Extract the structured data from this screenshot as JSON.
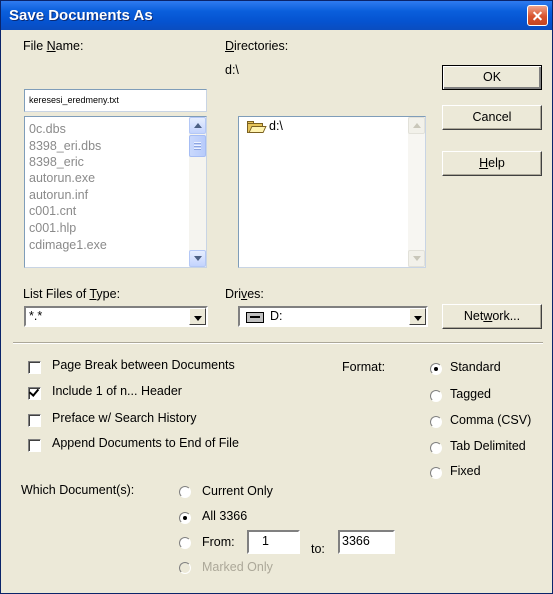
{
  "dialog": {
    "title": "Save Documents As"
  },
  "file_name": {
    "label_pre": "File ",
    "label_key": "N",
    "label_post": "ame:",
    "value": "keresesi_eredmeny.txt",
    "files": [
      "0c.dbs",
      "8398_eri.dbs",
      "8398_eric",
      "autorun.exe",
      "autorun.inf",
      "c001.cnt",
      "c001.hlp",
      "cdimage1.exe"
    ]
  },
  "directories": {
    "label_key": "D",
    "label_post": "irectories:",
    "path": "d:\\",
    "items": [
      "d:\\"
    ]
  },
  "buttons": {
    "ok": "OK",
    "cancel": "Cancel",
    "help_key": "H",
    "help_post": "elp",
    "network_pre": "Net",
    "network_key": "w",
    "network_post": "ork..."
  },
  "list_type": {
    "label_pre": "List Files of ",
    "label_key": "T",
    "label_post": "ype:",
    "value": "*.*"
  },
  "drives": {
    "label_pre": "Dri",
    "label_key": "v",
    "label_post": "es:",
    "value": "D:"
  },
  "options": [
    {
      "label": "Page Break between Documents",
      "checked": false
    },
    {
      "label": "Include 1 of n... Header",
      "checked": true
    },
    {
      "label": "Preface w/ Search History",
      "checked": false
    },
    {
      "label": "Append Documents to End of File",
      "checked": false
    }
  ],
  "format": {
    "label": "Format:",
    "options": [
      "Standard",
      "Tagged",
      "Comma (CSV)",
      "Tab Delimited",
      "Fixed"
    ],
    "selected": "Standard"
  },
  "which": {
    "label": "Which Document(s):",
    "current_only": "Current Only",
    "all": "All 3366",
    "from": "From:",
    "from_value": "1",
    "to": "to:",
    "to_value": "3366",
    "marked_only": "Marked Only",
    "selected": "All 3366"
  },
  "icons": {
    "close": "close-icon",
    "folder": "open-folder-icon",
    "drive": "drive-icon"
  }
}
